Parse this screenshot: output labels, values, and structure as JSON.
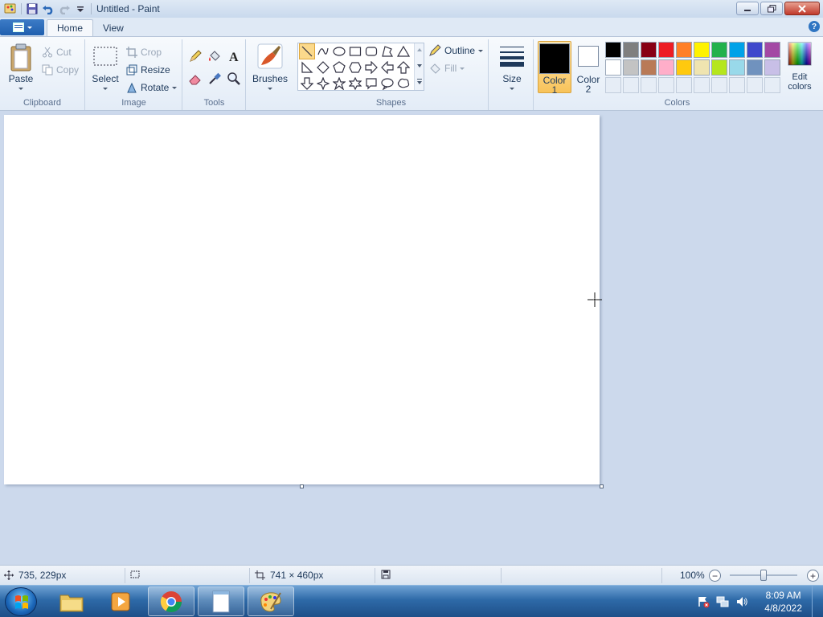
{
  "window": {
    "title": "Untitled - Paint"
  },
  "tabs": [
    {
      "label": "Home"
    },
    {
      "label": "View"
    }
  ],
  "clipboard": {
    "paste_label": "Paste",
    "cut_label": "Cut",
    "copy_label": "Copy",
    "group_label": "Clipboard"
  },
  "image": {
    "select_label": "Select",
    "crop_label": "Crop",
    "resize_label": "Resize",
    "rotate_label": "Rotate",
    "group_label": "Image"
  },
  "tools": {
    "group_label": "Tools",
    "items": [
      "pencil-icon",
      "fill-bucket-icon",
      "text-icon",
      "eraser-icon",
      "color-picker-icon",
      "magnifier-icon"
    ]
  },
  "brushes": {
    "label": "Brushes"
  },
  "shapes": {
    "group_label": "Shapes",
    "outline_label": "Outline",
    "fill_label": "Fill",
    "items": [
      "line",
      "curve",
      "oval",
      "rectangle",
      "rounded-rectangle",
      "polygon",
      "triangle",
      "right-triangle",
      "diamond",
      "pentagon",
      "hexagon",
      "right-arrow",
      "left-arrow",
      "up-arrow",
      "down-arrow",
      "four-point-star",
      "five-point-star",
      "six-point-star",
      "rounded-callout",
      "oval-callout",
      "cloud-callout"
    ]
  },
  "size": {
    "label": "Size"
  },
  "colors": {
    "group_label": "Colors",
    "color1_label_1": "Color",
    "color1_label_2": "1",
    "color2_label_1": "Color",
    "color2_label_2": "2",
    "edit_label_1": "Edit",
    "edit_label_2": "colors",
    "color1": "#000000",
    "color2": "#ffffff",
    "row1": [
      "#000000",
      "#7f7f7f",
      "#880015",
      "#ed1c24",
      "#ff7f27",
      "#fff200",
      "#22b14c",
      "#00a2e8",
      "#3f48cc",
      "#a349a4"
    ],
    "row2": [
      "#ffffff",
      "#c3c3c3",
      "#b97a57",
      "#ffaec9",
      "#ffc90e",
      "#efe4b0",
      "#b5e61d",
      "#99d9ea",
      "#7092be",
      "#c8bfe7"
    ]
  },
  "status": {
    "cursor_pos": "735, 229px",
    "canvas_size": "741 × 460px",
    "zoom": "100%"
  },
  "taskbar": {
    "time": "8:09 AM",
    "date": "4/8/2022"
  }
}
